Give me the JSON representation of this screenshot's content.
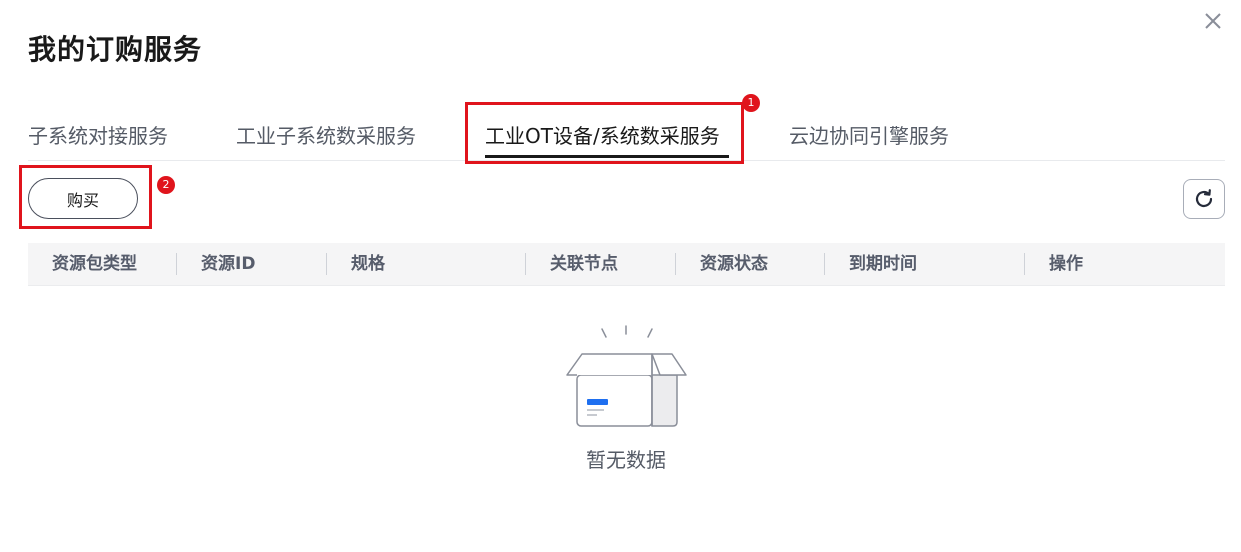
{
  "dialog": {
    "title": "我的订购服务"
  },
  "tabs": [
    {
      "label": "子系统对接服务"
    },
    {
      "label": "工业子系统数采服务"
    },
    {
      "label": "工业OT设备/系统数采服务"
    },
    {
      "label": "云边协同引擎服务"
    }
  ],
  "active_tab_index": 2,
  "markers": {
    "tab": "1",
    "buy": "2"
  },
  "toolbar": {
    "buy_label": "购买"
  },
  "table": {
    "columns": [
      "资源包类型",
      "资源ID",
      "规格",
      "关联节点",
      "资源状态",
      "到期时间",
      "操作"
    ],
    "rows": []
  },
  "empty_state": {
    "text": "暂无数据"
  },
  "icons": {
    "close": "close-icon",
    "refresh": "refresh-icon",
    "empty": "empty-box-icon"
  },
  "colors": {
    "highlight": "#e0141c",
    "accent": "#1e6ff0"
  }
}
